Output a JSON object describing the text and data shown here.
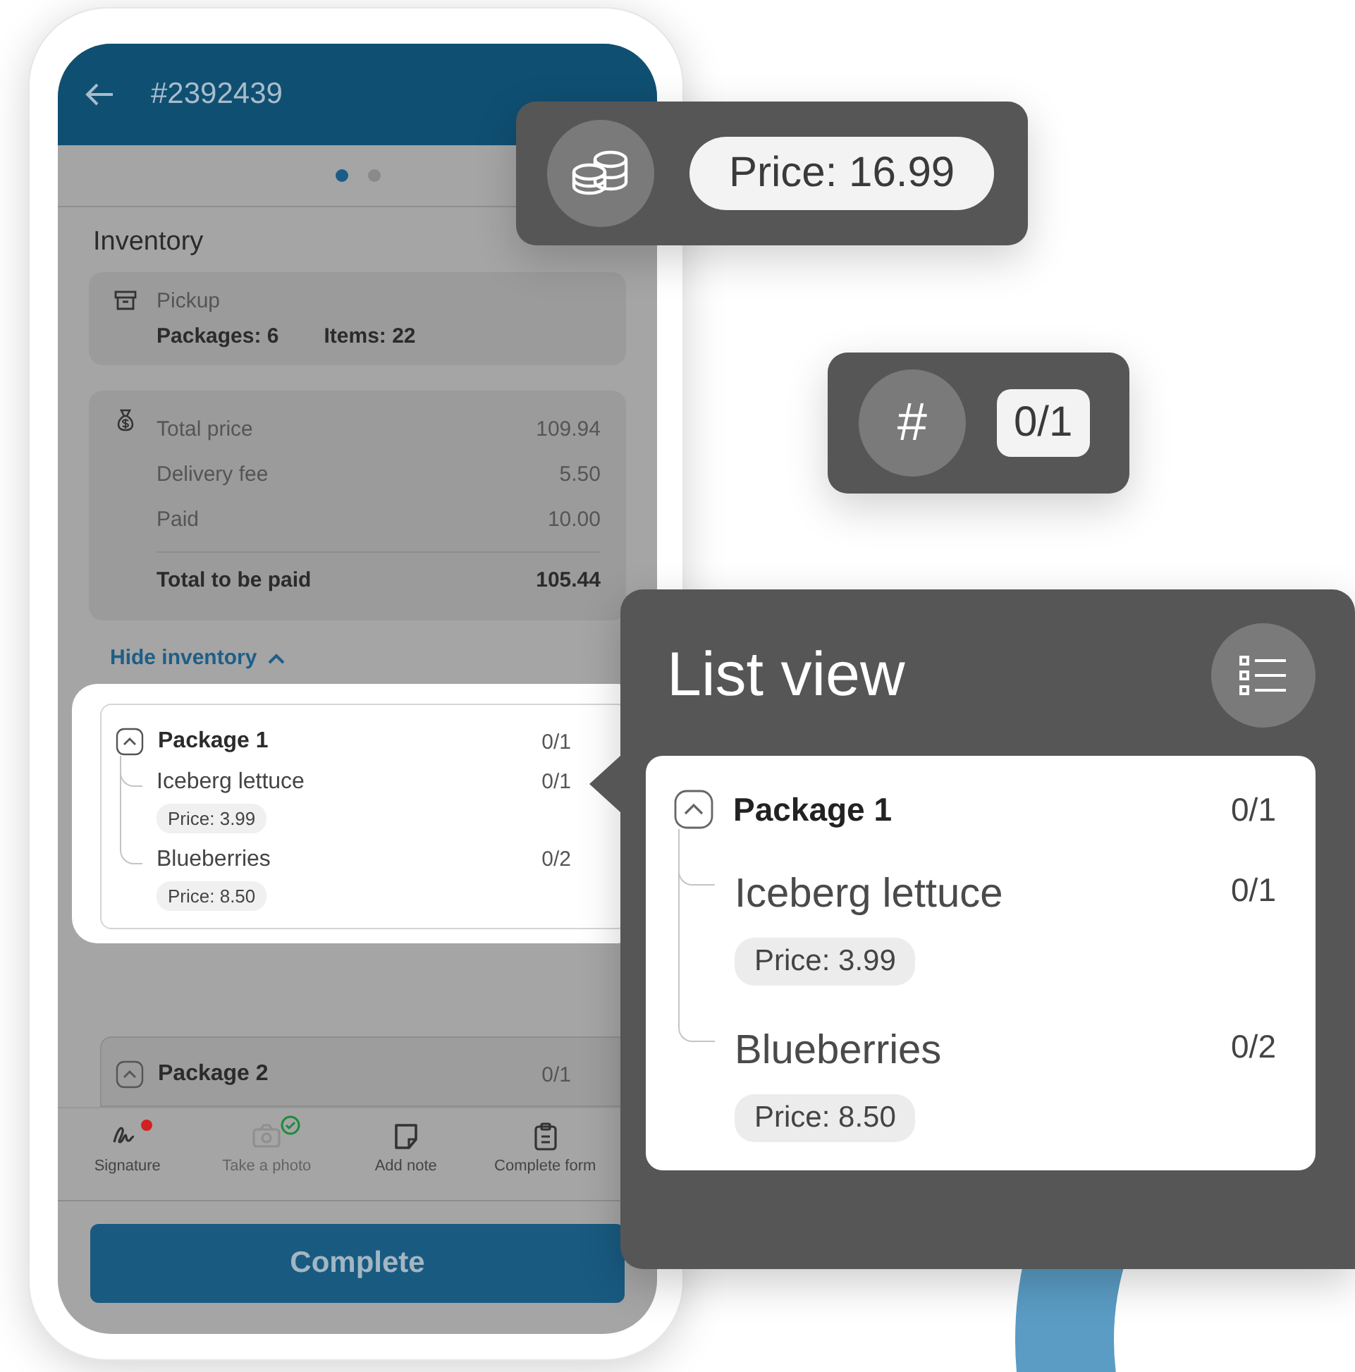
{
  "phone": {
    "header": {
      "title": "#2392439"
    },
    "pager": [
      {
        "selected": true
      },
      {
        "selected": false
      }
    ],
    "section_title": "Inventory",
    "pickup": {
      "label": "Pickup",
      "packages": "Packages: 6",
      "items": "Items: 22"
    },
    "totals": [
      {
        "label": "Total price",
        "value": "109.94",
        "kind": "line"
      },
      {
        "label": "Delivery fee",
        "value": "5.50",
        "kind": "line"
      },
      {
        "label": "Paid",
        "value": "10.00",
        "kind": "line"
      },
      {
        "label": "Total to be paid",
        "value": "105.44",
        "kind": "total"
      }
    ],
    "toggle_link": "Hide inventory",
    "packages": [
      {
        "name": "Package 1",
        "count": "0/1",
        "highlighted": true,
        "children": [
          {
            "name": "Iceberg lettuce",
            "count": "0/1",
            "price": "Price: 3.99"
          },
          {
            "name": "Blueberries",
            "count": "0/2",
            "price": "Price: 8.50"
          }
        ]
      },
      {
        "name": "Package 2",
        "count": "0/1",
        "highlighted": false
      }
    ],
    "actions": [
      {
        "label": "Signature",
        "kind": "signature",
        "disabled": false,
        "alert": true,
        "done": false
      },
      {
        "label": "Take a photo",
        "kind": "camera",
        "disabled": true,
        "alert": false,
        "done": true
      },
      {
        "label": "Add note",
        "kind": "note",
        "disabled": false,
        "alert": false,
        "done": false
      },
      {
        "label": "Complete form",
        "kind": "form",
        "disabled": false,
        "alert": false,
        "done": false
      }
    ],
    "primary_button": "Complete"
  },
  "callouts": [
    {
      "kind": "price",
      "text": "Price: 16.99"
    },
    {
      "kind": "quantity",
      "icon_text": "#",
      "text": "0/1"
    }
  ],
  "list_view": {
    "title": "List view",
    "package": {
      "name": "Package 1",
      "count": "0/1",
      "children": [
        {
          "name": "Iceberg lettuce",
          "count": "0/1",
          "price": "Price: 3.99"
        },
        {
          "name": "Blueberries",
          "count": "0/2",
          "price": "Price: 8.50"
        }
      ]
    }
  }
}
